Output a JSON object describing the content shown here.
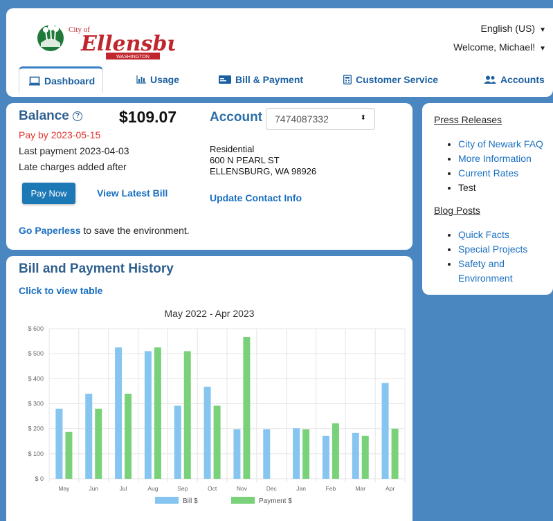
{
  "header": {
    "logo_text": "City of Ellensburg WASHINGTON",
    "language": "English (US)",
    "welcome": "Welcome, Michael!",
    "tabs": [
      {
        "label": "Dashboard",
        "icon": "monitor-icon",
        "active": true
      },
      {
        "label": "Usage",
        "icon": "bar-chart-icon"
      },
      {
        "label": "Bill & Payment",
        "icon": "credit-card-icon"
      },
      {
        "label": "Customer Service",
        "icon": "calculator-icon"
      },
      {
        "label": "Accounts",
        "icon": "users-icon"
      }
    ]
  },
  "balance": {
    "title": "Balance",
    "amount": "$109.07",
    "pay_by": "Pay by 2023-05-15",
    "last_payment": "Last payment 2023-04-03",
    "late_charges": "Late charges added after",
    "pay_now": "Pay Now",
    "view_bill": "View Latest Bill",
    "paperless_link": "Go Paperless",
    "paperless_text": " to save the environment."
  },
  "account": {
    "title": "Account",
    "number": "7474087332",
    "type": "Residential",
    "street": "600 N PEARL ST",
    "city": "ELLENSBURG, WA 98926",
    "update": "Update Contact Info"
  },
  "history": {
    "title": "Bill and Payment History",
    "table_link": "Click to view table"
  },
  "chart_data": {
    "type": "bar",
    "title": "May 2022 - Apr 2023",
    "categories": [
      "May",
      "Jun",
      "Jul",
      "Aug",
      "Sep",
      "Oct",
      "Nov",
      "Dec",
      "Jan",
      "Feb",
      "Mar",
      "Apr"
    ],
    "series": [
      {
        "name": "Bill $",
        "color": "#86c5f0",
        "values": [
          280,
          340,
          525,
          510,
          292,
          368,
          198,
          198,
          202,
          172,
          183,
          383
        ]
      },
      {
        "name": "Payment $",
        "color": "#79d27a",
        "values": [
          188,
          280,
          340,
          525,
          510,
          292,
          567,
          0,
          198,
          222,
          172,
          200
        ]
      }
    ],
    "yticks": [
      "$ 0",
      "$ 100",
      "$ 200",
      "$ 300",
      "$ 400",
      "$ 500",
      "$ 600"
    ],
    "ylim": [
      0,
      600
    ],
    "legend": "bottom"
  },
  "sidebar": {
    "press_title": "Press Releases",
    "press_items": [
      "City of Newark FAQ",
      "More Information",
      "Current Rates",
      "Test"
    ],
    "blog_title": "Blog Posts",
    "blog_items": [
      "Quick Facts",
      "Special Projects",
      "Safety and Environment"
    ]
  }
}
